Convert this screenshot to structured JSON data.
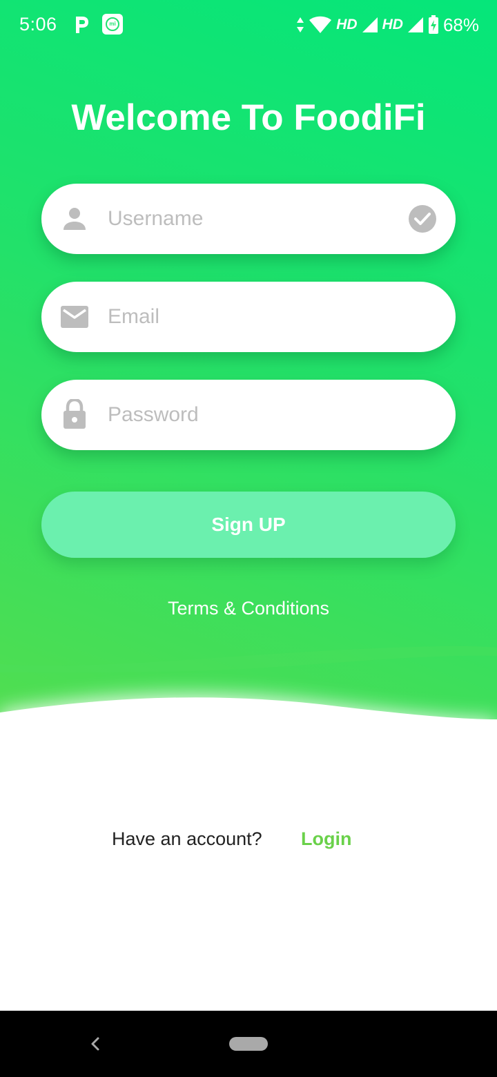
{
  "status_bar": {
    "time": "5:06",
    "network_1": "HD",
    "network_2": "HD",
    "battery": "68%",
    "icons": [
      "p-app-icon",
      "mi-app-icon",
      "data-arrows-icon",
      "wifi-icon",
      "signal-icon",
      "signal-icon",
      "battery-charging-icon"
    ]
  },
  "title": "Welcome To FoodiFi",
  "form": {
    "username": {
      "placeholder": "Username",
      "value": "",
      "icon": "person-icon",
      "status_icon": "check-circle-icon"
    },
    "email": {
      "placeholder": "Email",
      "value": "",
      "icon": "mail-icon"
    },
    "password": {
      "placeholder": "Password",
      "value": "",
      "icon": "lock-icon"
    }
  },
  "signup_label": "Sign UP",
  "terms_label": "Terms & Conditions",
  "account": {
    "question": "Have an account?",
    "login_label": "Login"
  },
  "colors": {
    "gradient_top": "#05e67a",
    "gradient_bottom": "#55dd4e",
    "button": "#6bf0ae",
    "login_link": "#6ad14a",
    "icon_gray": "#bdbdbd"
  },
  "nav_bar": {
    "icons": [
      "back-icon",
      "home-pill-icon"
    ]
  }
}
